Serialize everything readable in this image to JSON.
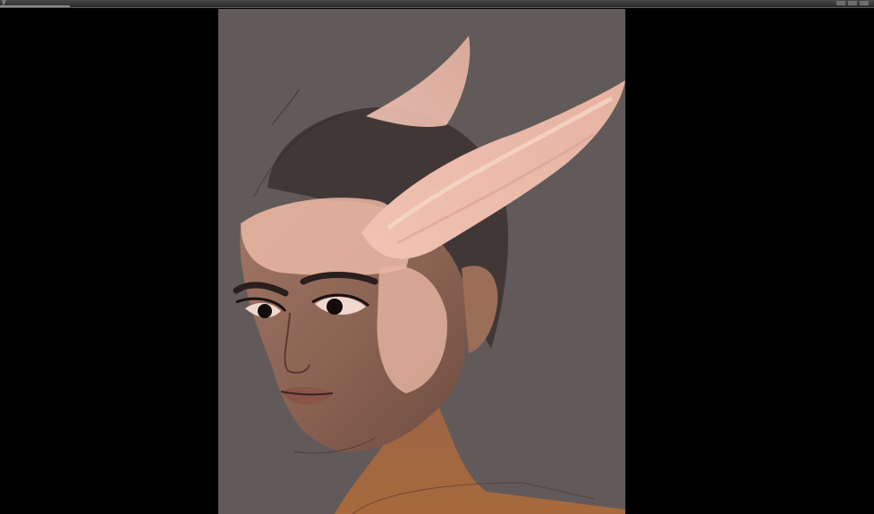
{
  "window": {
    "title": "y"
  },
  "viewport": {
    "background": "#000000"
  },
  "canvas": {
    "background": "#625a5a",
    "content": "digital-painting"
  },
  "icons": {
    "minimize": "minimize-icon",
    "maximize": "maximize-icon",
    "close": "close-icon"
  }
}
